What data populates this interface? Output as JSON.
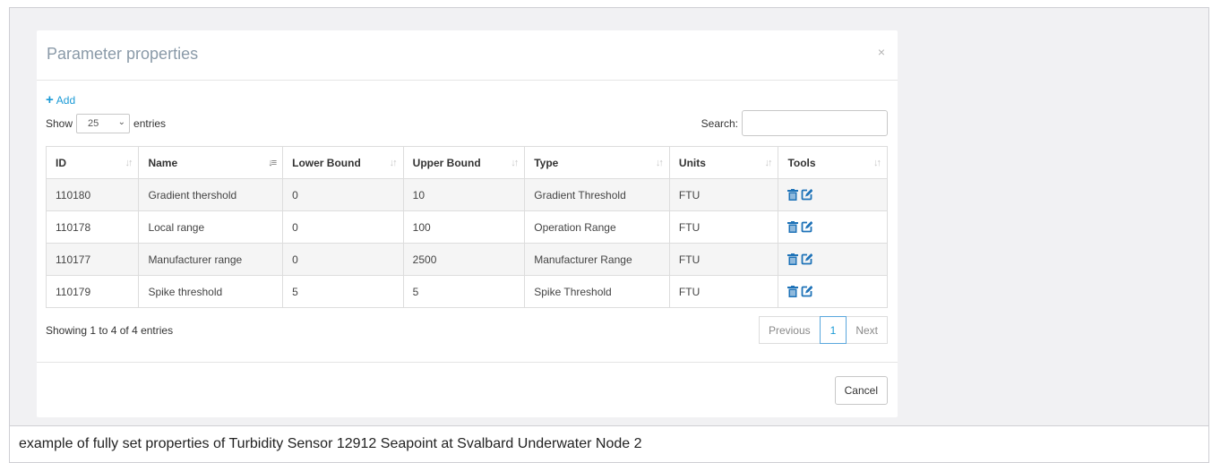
{
  "modal": {
    "title": "Parameter properties",
    "close_label": "×"
  },
  "toolbar": {
    "add_label": "Add",
    "show_label": "Show",
    "entries_value": "25",
    "entries_label": "entries",
    "search_label": "Search:",
    "search_value": ""
  },
  "table": {
    "columns": [
      "ID",
      "Name",
      "Lower Bound",
      "Upper Bound",
      "Type",
      "Units",
      "Tools"
    ],
    "rows": [
      {
        "id": "110180",
        "name": "Gradient thershold",
        "lower": "0",
        "upper": "10",
        "type": "Gradient Threshold",
        "units": "FTU"
      },
      {
        "id": "110178",
        "name": "Local range",
        "lower": "0",
        "upper": "100",
        "type": "Operation Range",
        "units": "FTU"
      },
      {
        "id": "110177",
        "name": "Manufacturer range",
        "lower": "0",
        "upper": "2500",
        "type": "Manufacturer Range",
        "units": "FTU"
      },
      {
        "id": "110179",
        "name": "Spike threshold",
        "lower": "5",
        "upper": "5",
        "type": "Spike Threshold",
        "units": "FTU"
      }
    ]
  },
  "footer": {
    "info": "Showing 1 to 4 of 4 entries",
    "previous": "Previous",
    "current_page": "1",
    "next": "Next",
    "cancel": "Cancel"
  },
  "caption": "example of fully set properties of Turbidity Sensor 12912 Seapoint at Svalbard Underwater Node 2",
  "colors": {
    "accent": "#1a9ad6",
    "icon": "#1f73b8",
    "title": "#8a9aa8"
  }
}
